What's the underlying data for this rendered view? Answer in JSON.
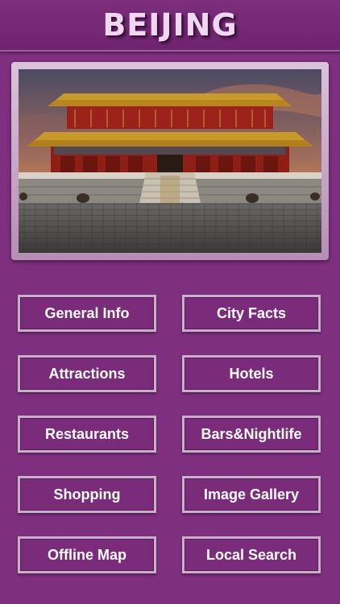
{
  "header": {
    "title": "BEIJING"
  },
  "photo": {
    "subject": "palace-photo"
  },
  "menu": {
    "general_info": "General Info",
    "city_facts": "City Facts",
    "attractions": "Attractions",
    "hotels": "Hotels",
    "restaurants": "Restaurants",
    "bars_nightlife": "Bars&Nightlife",
    "shopping": "Shopping",
    "image_gallery": "Image Gallery",
    "offline_map": "Offline Map",
    "local_search": "Local Search"
  },
  "colors": {
    "background": "#7e2f7e",
    "header": "#6f2470",
    "title": "#efd8ef",
    "button_border": "#c9b0c9",
    "button_text": "#ffffff"
  }
}
